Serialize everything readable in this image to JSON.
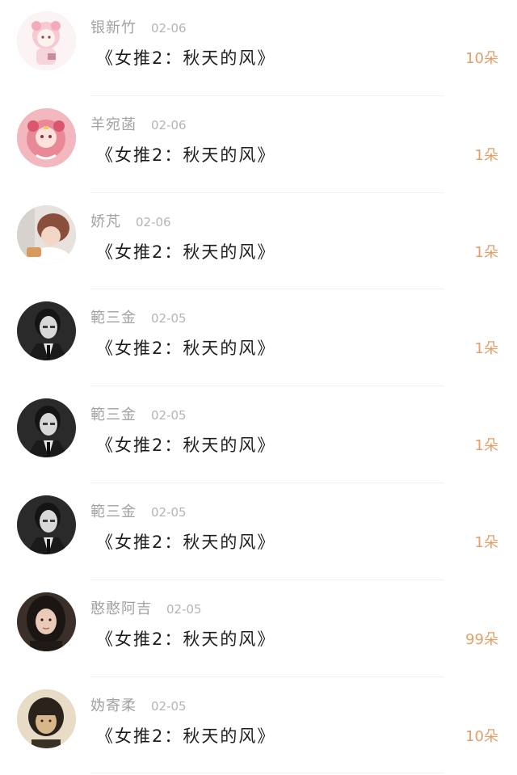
{
  "gift_list": [
    {
      "user": "银新竹",
      "date": "02-06",
      "title": "《女推2：秋天的风》",
      "count": "10朵",
      "avatar": "anime-pink-avatar"
    },
    {
      "user": "羊宛菡",
      "date": "02-06",
      "title": "《女推2：秋天的风》",
      "count": "1朵",
      "avatar": "anime-sailor-avatar"
    },
    {
      "user": "娇芃",
      "date": "02-06",
      "title": "《女推2：秋天的风》",
      "count": "1朵",
      "avatar": "girl-selfie-avatar"
    },
    {
      "user": "範三金",
      "date": "02-05",
      "title": "《女推2：秋天的风》",
      "count": "1朵",
      "avatar": "bw-portrait-avatar"
    },
    {
      "user": "範三金",
      "date": "02-05",
      "title": "《女推2：秋天的风》",
      "count": "1朵",
      "avatar": "bw-portrait-avatar"
    },
    {
      "user": "範三金",
      "date": "02-05",
      "title": "《女推2：秋天的风》",
      "count": "1朵",
      "avatar": "bw-portrait-avatar"
    },
    {
      "user": "憨憨阿吉",
      "date": "02-05",
      "title": "《女推2：秋天的风》",
      "count": "99朵",
      "avatar": "dark-hair-avatar"
    },
    {
      "user": "妫寄柔",
      "date": "02-05",
      "title": "《女推2：秋天的风》",
      "count": "10朵",
      "avatar": "sepia-portrait-avatar"
    }
  ],
  "colors": {
    "name": "#a2a2a2",
    "date": "#b5b5b5",
    "title": "#1e1e1e",
    "count": "#e0a06a",
    "divider": "#f1f1f1"
  }
}
